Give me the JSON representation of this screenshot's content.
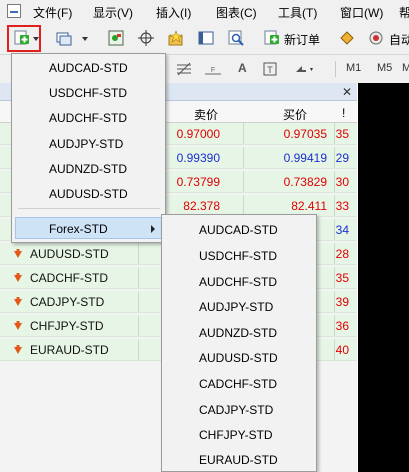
{
  "menubar": {
    "items": [
      "文件(F)",
      "显示(V)",
      "插入(I)",
      "图表(C)",
      "工具(T)",
      "窗口(W)",
      "帮助"
    ]
  },
  "toolbar": {
    "new_order_label": "新订单",
    "auto_trade_label": "自动"
  },
  "toolbar2": {
    "items": [
      "A",
      "M1",
      "M5",
      "M"
    ]
  },
  "market_watch": {
    "columns": {
      "bid": "卖价",
      "ask": "买价",
      "spread": "!"
    },
    "rows": [
      {
        "symbol": "",
        "bid": "0.97000",
        "ask": "0.97035",
        "spread": "35",
        "bid_color": "red",
        "ask_color": "red",
        "spread_color": "red"
      },
      {
        "symbol": "",
        "bid": "0.99390",
        "ask": "0.99419",
        "spread": "29",
        "bid_color": "blue",
        "ask_color": "blue",
        "spread_color": "blue"
      },
      {
        "symbol": "",
        "bid": "0.73799",
        "ask": "0.73829",
        "spread": "30",
        "bid_color": "red",
        "ask_color": "red",
        "spread_color": "red"
      },
      {
        "symbol": "",
        "bid": "82.378",
        "ask": "82.411",
        "spread": "33",
        "bid_color": "red",
        "ask_color": "red",
        "spread_color": "red"
      },
      {
        "symbol": "",
        "bid": "",
        "ask": "",
        "spread": "34",
        "bid_color": "blue",
        "ask_color": "blue",
        "spread_color": "blue"
      },
      {
        "symbol": "AUDUSD-STD",
        "bid": "",
        "ask": "",
        "spread": "28",
        "bid_color": "red",
        "ask_color": "red",
        "spread_color": "red"
      },
      {
        "symbol": "CADCHF-STD",
        "bid": "",
        "ask": "",
        "spread": "35",
        "bid_color": "red",
        "ask_color": "red",
        "spread_color": "red"
      },
      {
        "symbol": "CADJPY-STD",
        "bid": "",
        "ask": "",
        "spread": "39",
        "bid_color": "red",
        "ask_color": "red",
        "spread_color": "red"
      },
      {
        "symbol": "CHFJPY-STD",
        "bid": "",
        "ask": "",
        "spread": "36",
        "bid_color": "red",
        "ask_color": "red",
        "spread_color": "red"
      },
      {
        "symbol": "EURAUD-STD",
        "bid": "",
        "ask": "",
        "spread": "40",
        "bid_color": "red",
        "ask_color": "red",
        "spread_color": "red"
      }
    ]
  },
  "dropdown": {
    "items": [
      "AUDCAD-STD",
      "USDCHF-STD",
      "AUDCHF-STD",
      "AUDJPY-STD",
      "AUDNZD-STD",
      "AUDUSD-STD"
    ],
    "submenu_label": "Forex-STD"
  },
  "submenu": {
    "items": [
      "AUDCAD-STD",
      "USDCHF-STD",
      "AUDCHF-STD",
      "AUDJPY-STD",
      "AUDNZD-STD",
      "AUDUSD-STD",
      "CADCHF-STD",
      "CADJPY-STD",
      "CHFJPY-STD",
      "EURAUD-STD"
    ]
  },
  "colors": {
    "red": "#e00000",
    "blue": "#1a2fd0",
    "row_bg": "#e6f5e6",
    "highlight": "#e0201f"
  }
}
